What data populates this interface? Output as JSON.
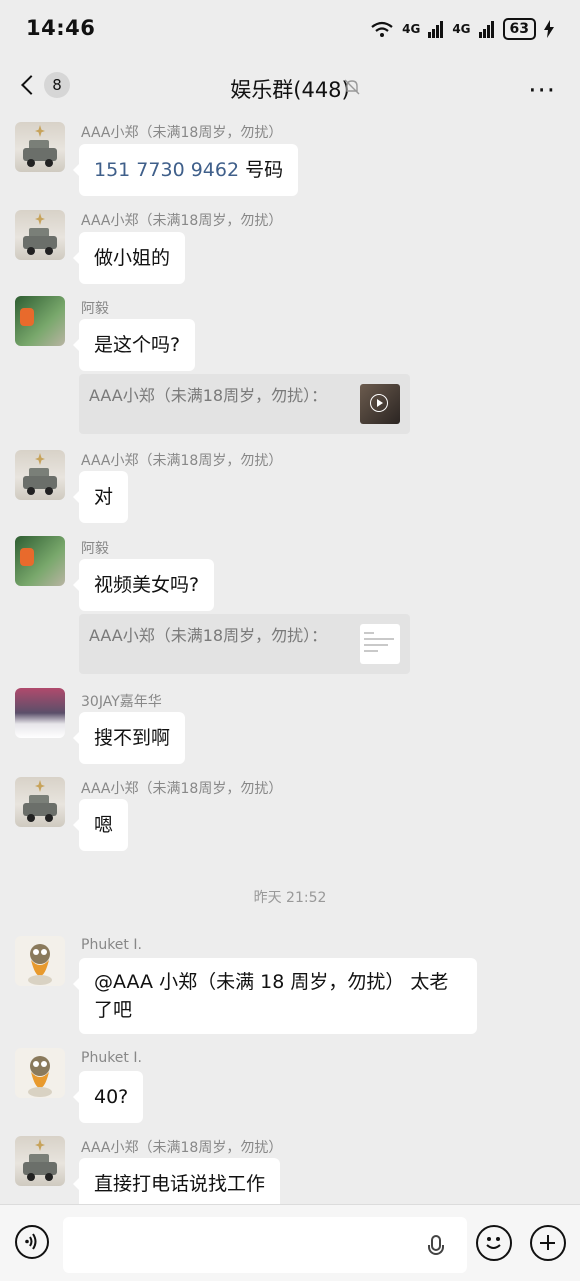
{
  "status_bar": {
    "time": "14:46",
    "network_1": "4G",
    "network_2": "4G",
    "battery": "63"
  },
  "nav": {
    "back_badge": "8",
    "title": "娱乐群(448)",
    "more": "···"
  },
  "messages": [
    {
      "sender": "AAA小郑（未满18周岁，勿扰）",
      "phone": "151 7730 9462",
      "suffix": "号码"
    },
    {
      "sender": "AAA小郑（未满18周岁，勿扰）",
      "text": "做小姐的"
    },
    {
      "sender": "阿毅",
      "text": "是这个吗?",
      "quote": "AAA小郑（未满18周岁，勿扰）："
    },
    {
      "sender": "AAA小郑（未满18周岁，勿扰）",
      "text": "对"
    },
    {
      "sender": "阿毅",
      "text": "视频美女吗?",
      "quote": "AAA小郑（未满18周岁，勿扰）："
    },
    {
      "sender": "30JAY嘉年华",
      "text": "搜不到啊"
    },
    {
      "sender": "AAA小郑（未满18周岁，勿扰）",
      "text": "嗯"
    },
    {
      "sender": "Phuket I.",
      "text": "@AAA 小郑（未满 18 周岁，勿扰） 太老了吧"
    },
    {
      "sender": "Phuket I.",
      "text": "40?"
    },
    {
      "sender": "AAA小郑（未满18周岁，勿扰）",
      "text": "直接打电话说找工作"
    }
  ],
  "timestamp": "昨天 21:52",
  "input": {
    "placeholder": ""
  }
}
